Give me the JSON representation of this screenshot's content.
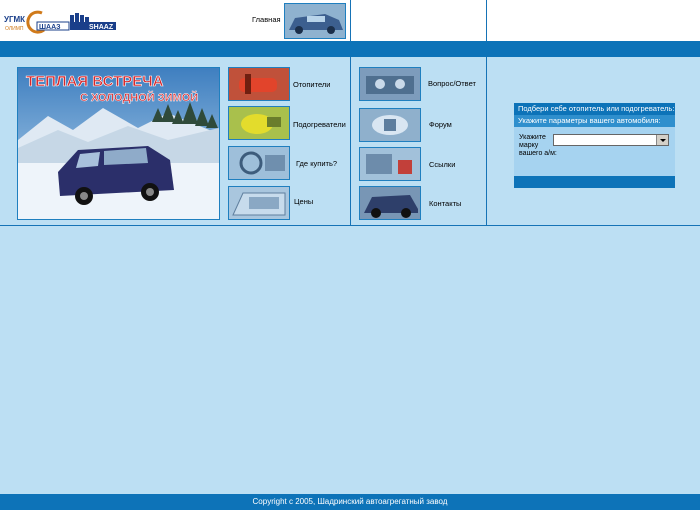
{
  "header": {
    "logo_left": "УГМК",
    "logo_left_sub": "ОЛИМП",
    "logo_mid": "ШААЗ",
    "logo_right": "SHAAZ",
    "home_label": "Главная"
  },
  "nav": {
    "items": [
      {
        "label": "Отопители"
      },
      {
        "label": "Подогреватели"
      },
      {
        "label": "Где купить?"
      },
      {
        "label": "Цены"
      },
      {
        "label": "Вопрос/Ответ"
      },
      {
        "label": "Форум"
      },
      {
        "label": "Ссылки"
      },
      {
        "label": "Контакты"
      }
    ]
  },
  "banner": {
    "line1": "ТЕПЛАЯ ВСТРЕЧА",
    "line2": "С ХОЛОДНОЙ ЗИМОЙ"
  },
  "panel": {
    "title": "Подбери себе отопитель или подогреватель:",
    "subtitle": "Укажите параметры вашего автомобиля:",
    "field_label": "Укажите марку вашего а/м:",
    "select_value": ""
  },
  "footer": {
    "copyright": "Copyright  с  2005, Шадринский автоагрегатный завод"
  },
  "colors": {
    "accent": "#0d73b8",
    "background": "#bcdff3"
  }
}
